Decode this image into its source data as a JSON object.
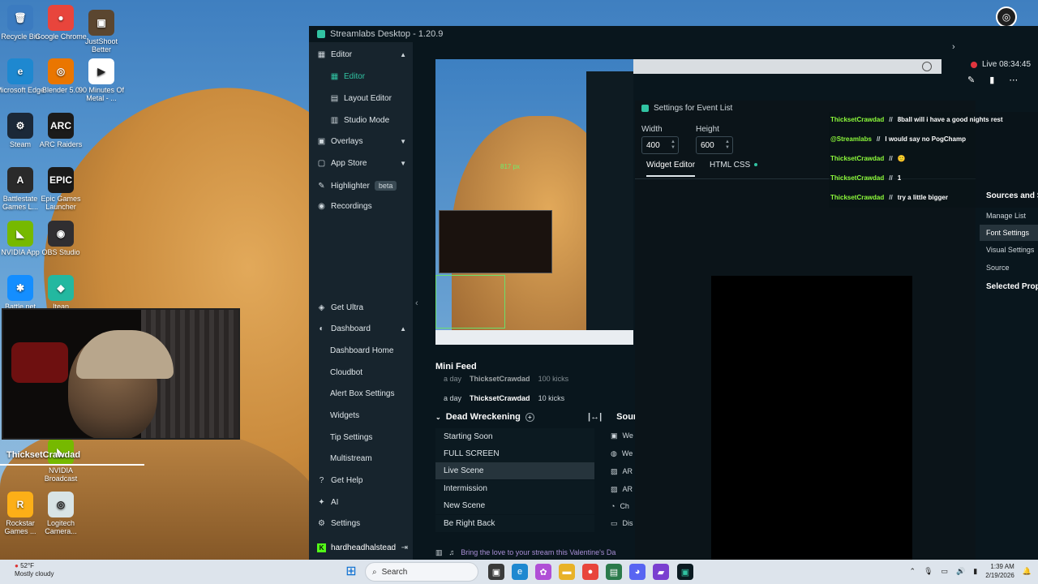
{
  "desktop": {
    "icons": [
      {
        "label": "Recycle Bin",
        "glyph": "🗑",
        "bg": "#3b7bc0"
      },
      {
        "label": "Google Chrome",
        "glyph": "●",
        "bg": "#e8453c"
      },
      {
        "label": "JustShoot Better",
        "glyph": "▣",
        "bg": "#5b4630"
      },
      {
        "label": "Microsoft Edge",
        "glyph": "e",
        "bg": "#1e88d0"
      },
      {
        "label": "Blender 5.0",
        "glyph": "◎",
        "bg": "#ea7600"
      },
      {
        "label": "90 Minutes Of Metal - ...",
        "glyph": "▶",
        "bg": "#ffffff"
      },
      {
        "label": "Steam",
        "glyph": "⚙",
        "bg": "#1b2838"
      },
      {
        "label": "ARC Raiders",
        "glyph": "ARC",
        "bg": "#1b1b1b"
      },
      {
        "label": "Battlestate Games L...",
        "glyph": "A",
        "bg": "#2a2a2a"
      },
      {
        "label": "Epic Games Launcher",
        "glyph": "EPIC",
        "bg": "#1a1a1a"
      },
      {
        "label": "NVIDIA App",
        "glyph": "◣",
        "bg": "#76b900"
      },
      {
        "label": "OBS Studio",
        "glyph": "◉",
        "bg": "#302e31"
      },
      {
        "label": "Battle.net",
        "glyph": "✱",
        "bg": "#148eff"
      },
      {
        "label": "Itean",
        "glyph": "◆",
        "bg": "#23b8a0"
      },
      {
        "label": "NVIDIA Broadcast",
        "glyph": "◣",
        "bg": "#76b900"
      },
      {
        "label": "Rockstar Games ...",
        "glyph": "R",
        "bg": "#fcaf17"
      },
      {
        "label": "Logitech Camera...",
        "glyph": "◎",
        "bg": "#d8e4e6"
      }
    ],
    "cam_label": "ThicksetCrawdad"
  },
  "app": {
    "title": "Streamlabs Desktop - 1.20.9",
    "sidebar": {
      "editor": "Editor",
      "editor_sub": [
        "Editor",
        "Layout Editor",
        "Studio Mode"
      ],
      "overlays": "Overlays",
      "app_store": "App Store",
      "highlighter": "Highlighter",
      "beta": "beta",
      "recordings": "Recordings",
      "get_ultra": "Get Ultra",
      "dashboard": "Dashboard",
      "dashboard_sub": [
        "Dashboard Home",
        "Cloudbot",
        "Alert Box Settings",
        "Widgets",
        "Tip Settings",
        "Multistream"
      ],
      "get_help": "Get Help",
      "ai": "AI",
      "settings": "Settings",
      "account": "hardheadhalstead"
    },
    "live": {
      "label": "Live 08:34:45"
    },
    "preview": {
      "dim_text": "817 px"
    },
    "mini_feed": {
      "title": "Mini Feed",
      "rows": [
        {
          "time": "a day",
          "name": "ThicksetCrawdad",
          "detail": "100 kicks"
        },
        {
          "time": "a day",
          "name": "ThicksetCrawdad",
          "detail": "10 kicks"
        }
      ]
    },
    "scenes": {
      "collection": "Dead Wreckening",
      "items": [
        "Starting Soon",
        "FULL SCREEN",
        "Live Scene",
        "Intermission",
        "New Scene",
        "Be Right Back"
      ],
      "selected": "Live Scene"
    },
    "sources": {
      "title": "Source",
      "items": [
        "We",
        "We",
        "AR",
        "AR",
        "Ch",
        "Dis"
      ]
    },
    "banner": "Bring the love to your stream this Valentine's Da"
  },
  "dialog": {
    "title": "Settings for Event List",
    "width_label": "Width",
    "width_value": "400",
    "height_label": "Height",
    "height_value": "600",
    "tabs": [
      "Widget Editor",
      "HTML CSS"
    ]
  },
  "chat": [
    {
      "user": "ThicksetCrawdad",
      "msg": "8ball will i have a good nights rest"
    },
    {
      "user": "@Streamlabs",
      "msg": "I would say no PogChamp"
    },
    {
      "user": "ThicksetCrawdad",
      "msg": "🙂"
    },
    {
      "user": "ThicksetCrawdad",
      "msg": "1"
    },
    {
      "user": "ThicksetCrawdad",
      "msg": "try a little bigger"
    }
  ],
  "right_panel": {
    "title": "Sources and S",
    "items": [
      "Manage List",
      "Font Settings",
      "Visual Settings",
      "Source"
    ],
    "active": "Font Settings",
    "selected_props": "Selected Prop"
  },
  "taskbar": {
    "temp": "52°F",
    "weather": "Mostly cloudy",
    "search": "Search",
    "time": "1:39 AM",
    "date": "2/19/2026"
  }
}
